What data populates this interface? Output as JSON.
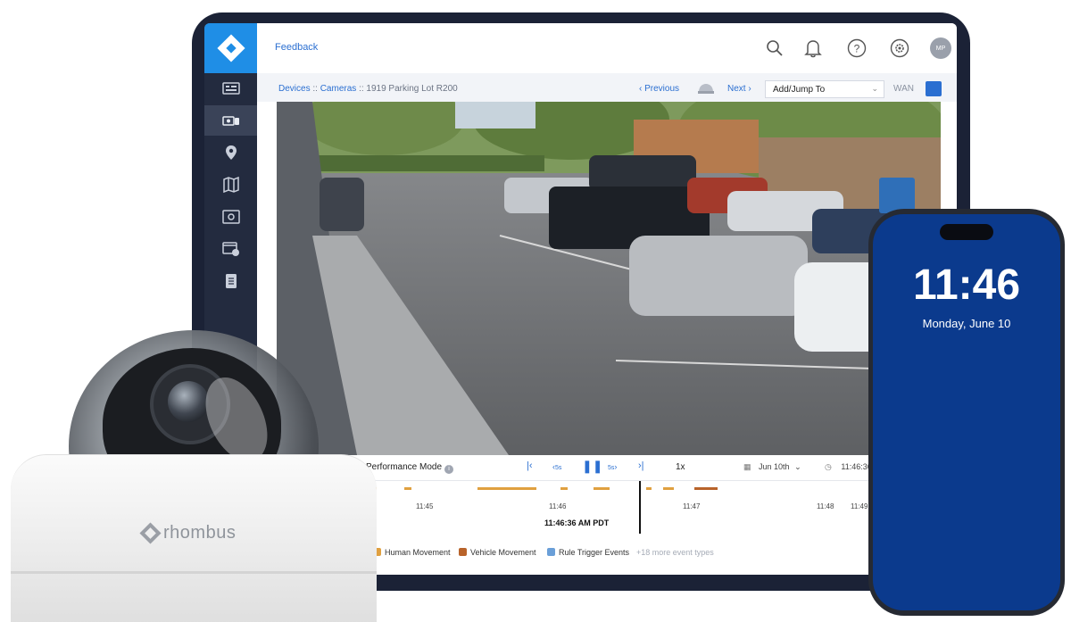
{
  "topbar": {
    "feedback_label": "Feedback",
    "avatar_initials": "MP"
  },
  "breadcrumb": {
    "devices": "Devices",
    "separator": "::",
    "cameras": "Cameras",
    "camera_name": "1919 Parking Lot R200"
  },
  "nav": {
    "previous_label": "Previous",
    "next_label": "Next",
    "jump_placeholder": "Add/Jump To",
    "network_label": "WAN"
  },
  "sidebar": {
    "items": [
      {
        "icon": "dashboard-icon",
        "active": false
      },
      {
        "icon": "cameras-icon",
        "active": true
      },
      {
        "icon": "location-pin-icon",
        "active": false
      },
      {
        "icon": "map-icon",
        "active": false
      },
      {
        "icon": "video-wall-icon",
        "active": false
      },
      {
        "icon": "clips-icon",
        "active": false
      },
      {
        "icon": "reports-icon",
        "active": false
      }
    ]
  },
  "player": {
    "performance_mode_label": "Performance Mode",
    "skip_back_label": "5s",
    "skip_forward_label": "5s",
    "speed": "1x",
    "date": "Jun 10th",
    "time": "11:46:36 AM"
  },
  "timeline": {
    "ticks": [
      "11:45",
      "11:46",
      "11:47",
      "11:48",
      "11:49"
    ],
    "current_timestamp": "11:46:36 AM PDT"
  },
  "legend": {
    "items": [
      {
        "label": "Human Movement",
        "color": "#e0a040"
      },
      {
        "label": "Vehicle Movement",
        "color": "#b8632a"
      },
      {
        "label": "Rule Trigger Events",
        "color": "#6a9fd8"
      }
    ],
    "more": "+18 more event types"
  },
  "phone": {
    "time": "11:46",
    "date": "Monday, June 10"
  },
  "device": {
    "brand": "rhombus"
  },
  "colors": {
    "accent": "#1f8ee6",
    "sidebar": "#232b3f",
    "phone_bg": "#0b3a8d",
    "link": "#2b6fd1"
  }
}
